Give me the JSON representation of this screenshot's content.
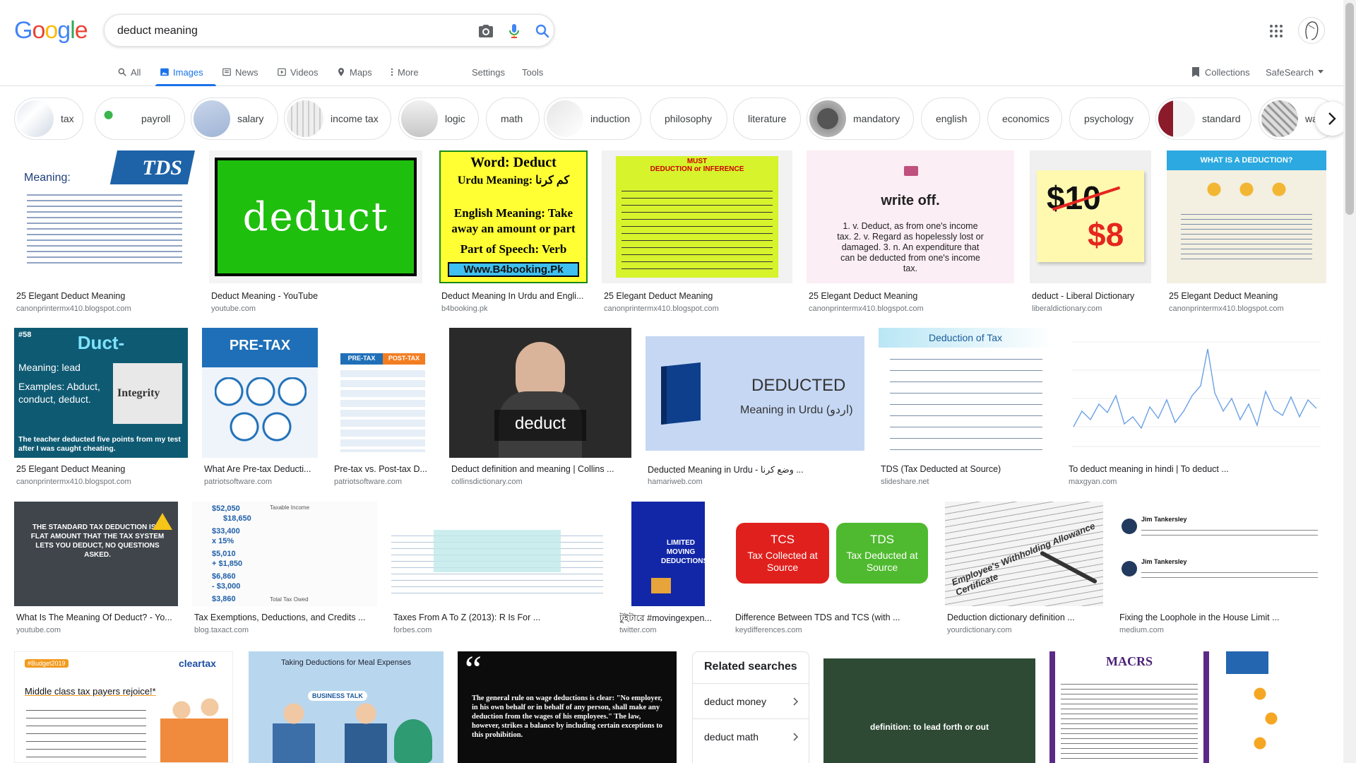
{
  "search": {
    "query": "deduct meaning",
    "placeholder": ""
  },
  "logo": {
    "letters": [
      "G",
      "o",
      "o",
      "g",
      "l",
      "e"
    ],
    "colors": [
      "#4285f4",
      "#ea4335",
      "#fbbc05",
      "#4285f4",
      "#34a853",
      "#ea4335"
    ]
  },
  "tabs": {
    "all": "All",
    "images": "Images",
    "news": "News",
    "videos": "Videos",
    "maps": "Maps",
    "more": "More",
    "settings": "Settings",
    "tools": "Tools"
  },
  "right": {
    "collections": "Collections",
    "safesearch": "SafeSearch"
  },
  "chips": [
    "tax",
    "payroll",
    "salary",
    "income tax",
    "logic",
    "math",
    "induction",
    "philosophy",
    "literature",
    "mandatory",
    "english",
    "economics",
    "psychology",
    "standard",
    "wa"
  ],
  "results": {
    "row1": [
      {
        "title": "25 Elegant Deduct Meaning",
        "source": "canonprintermx410.blogspot.com",
        "img_text": [
          "TDS",
          "Meaning:"
        ]
      },
      {
        "title": "Deduct Meaning - YouTube",
        "source": "youtube.com",
        "img_text": [
          "deduct"
        ]
      },
      {
        "title": "Deduct Meaning In Urdu and Engli...",
        "source": "b4booking.pk",
        "img_text": [
          "Word: Deduct",
          "Urdu Meaning: کم کرنا",
          "English Meaning: Take away an amount or part",
          "Part of Speech: Verb",
          "Www.B4booking.Pk"
        ]
      },
      {
        "title": "25 Elegant Deduct Meaning",
        "source": "canonprintermx410.blogspot.com",
        "img_text": [
          "MUST",
          "DEDUCTION or INFERENCE"
        ]
      },
      {
        "title": "25 Elegant Deduct Meaning",
        "source": "canonprintermx410.blogspot.com",
        "img_text": [
          "write off.",
          "1. v. Deduct, as from one's income tax. 2. v. Regard as hopelessly lost or damaged. 3. n. An expenditure that can be deducted from one's income tax."
        ]
      },
      {
        "title": "deduct - Liberal Dictionary",
        "source": "liberaldictionary.com",
        "img_text": [
          "$10",
          "$8"
        ]
      },
      {
        "title": "25 Elegant Deduct Meaning",
        "source": "canonprintermx410.blogspot.com",
        "img_text": [
          "WHAT IS A DEDUCTION?"
        ]
      }
    ],
    "row2": [
      {
        "title": "25 Elegant Deduct Meaning",
        "source": "canonprintermx410.blogspot.com",
        "img_text": [
          "#58",
          "Duct-",
          "Meaning: lead",
          "Examples: Abduct, conduct, deduct.",
          "Integrity",
          "The teacher deducted five points from my test after I was caught cheating."
        ]
      },
      {
        "title": "What Are Pre-tax Deducti...",
        "source": "patriotsoftware.com",
        "img_text": [
          "PRE-TAX"
        ]
      },
      {
        "title": "Pre-tax vs. Post-tax D...",
        "source": "patriotsoftware.com",
        "img_text": [
          "PRE-TAX",
          "POST-TAX"
        ]
      },
      {
        "title": "Deduct definition and meaning | Collins ...",
        "source": "collinsdictionary.com",
        "img_text": [
          "deduct"
        ]
      },
      {
        "title": "Deducted Meaning in Urdu - وضع کرنا ...",
        "source": "hamariweb.com",
        "img_text": [
          "DEDUCTED",
          "Meaning in Urdu (اردو)"
        ]
      },
      {
        "title": "TDS (Tax Deducted at Source)",
        "source": "slideshare.net",
        "img_text": [
          "Deduction of Tax"
        ]
      },
      {
        "title": "To deduct meaning in hindi | To deduct ...",
        "source": "maxgyan.com",
        "img_text": []
      }
    ],
    "row3": [
      {
        "title": "What Is The Meaning Of Deduct? - Yo...",
        "source": "youtube.com",
        "img_text": [
          "THE STANDARD TAX DEDUCTION IS A FLAT AMOUNT THAT THE TAX SYSTEM LETS YOU DEDUCT, NO QUESTIONS ASKED."
        ]
      },
      {
        "title": "Tax Exemptions, Deductions, and Credits ...",
        "source": "blog.taxact.com",
        "img_text": [
          "$52,050",
          "$18,650",
          "$33,400",
          "x 15%",
          "$5,010",
          "+ $1,850",
          "$6,860",
          "- $3,000",
          "$3,860",
          "Taxable Income",
          "Total Tax Owed"
        ]
      },
      {
        "title": "Taxes From A To Z (2013): R Is For ...",
        "source": "forbes.com",
        "img_text": []
      },
      {
        "title": "টুইটারে #movingexpen...",
        "source": "twitter.com",
        "img_text": [
          "LIMITED MOVING DEDUCTIONS"
        ]
      },
      {
        "title": "Difference Between TDS and TCS (with ...",
        "source": "keydifferences.com",
        "img_text": [
          "TCS",
          "Tax Collected at Source",
          "TDS",
          "Tax Deducted at Source"
        ]
      },
      {
        "title": "Deduction dictionary definition ...",
        "source": "yourdictionary.com",
        "img_text": [
          "Employee's Withholding Allowance Certificate"
        ]
      },
      {
        "title": "Fixing the Loophole in the House Limit ...",
        "source": "medium.com",
        "img_text": [
          "Jim Tankersley",
          "Jim Tankersley"
        ]
      }
    ],
    "row4": [
      {
        "img_text": [
          "#Budget2019",
          "cleartax",
          "Middle class tax payers rejoice!*"
        ]
      },
      {
        "img_text": [
          "Taking Deductions for Meal Expenses",
          "BUSINESS TALK"
        ]
      },
      {
        "img_text": [
          "“",
          "The general rule on wage deductions is clear: \"No employer, in his own behalf or in behalf of any person, shall make any deduction from the wages of his employees.\" The law, however, strikes a balance by including certain exceptions to this prohibition."
        ]
      },
      {
        "img_text": [
          "definition: to lead forth or out"
        ]
      },
      {
        "img_text": [
          "MACRS"
        ]
      },
      {
        "img_text": []
      }
    ]
  },
  "related": {
    "title": "Related searches",
    "items": [
      "deduct money",
      "deduct math"
    ]
  }
}
